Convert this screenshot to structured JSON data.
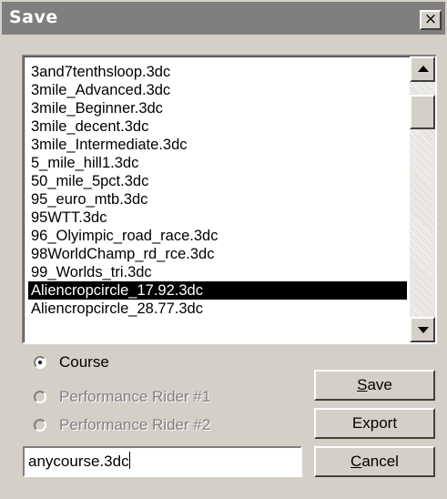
{
  "window": {
    "title": "Save",
    "close_label": "×"
  },
  "files": [
    "3and7tenthsloop.3dc",
    "3mile_Advanced.3dc",
    "3mile_Beginner.3dc",
    "3mile_decent.3dc",
    "3mile_Intermediate.3dc",
    "5_mile_hill1.3dc",
    "50_mile_5pct.3dc",
    "95_euro_mtb.3dc",
    "95WTT.3dc",
    "96_Olyimpic_road_race.3dc",
    "98WorldChamp_rd_rce.3dc",
    "99_Worlds_tri.3dc",
    "Aliencropcircle_17.92.3dc",
    "Aliencropcircle_28.77.3dc"
  ],
  "selected_file_index": 12,
  "scrollbar": {
    "up_icon": "arrow-up-icon",
    "down_icon": "arrow-down-icon",
    "scroll_position_percent": 10
  },
  "radios": [
    {
      "label": "Course",
      "checked": true,
      "enabled": true
    },
    {
      "label": "Performance Rider #1",
      "checked": false,
      "enabled": false
    },
    {
      "label": "Performance Rider #2",
      "checked": false,
      "enabled": false
    }
  ],
  "filename": {
    "value": "anycourse.3dc"
  },
  "buttons": {
    "save": {
      "pre": "",
      "accel": "S",
      "post": "ave"
    },
    "export": {
      "label": "Export"
    },
    "cancel": {
      "pre": "",
      "accel": "C",
      "post": "ancel"
    }
  },
  "colors": {
    "title_bar": "#7f7f7f",
    "dialog_bg": "#d4d0c8",
    "selection_bg": "#000000"
  }
}
